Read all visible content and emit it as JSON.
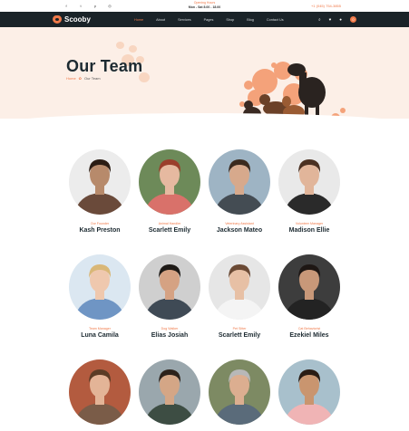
{
  "topbar": {
    "social_icons": [
      "facebook-icon",
      "twitter-icon",
      "pinterest-icon",
      "instagram-icon"
    ],
    "opening_title": "Opening Hours",
    "opening_value": "Mon - Sat 8.00 - 18.00",
    "phone": "+1 (045) 754-3855"
  },
  "nav": {
    "brand": "Scooby",
    "items": [
      {
        "label": "Home",
        "active": true
      },
      {
        "label": "About",
        "active": false
      },
      {
        "label": "Services",
        "active": false
      },
      {
        "label": "Pages",
        "active": false
      },
      {
        "label": "Shop",
        "active": false
      },
      {
        "label": "Blog",
        "active": false
      },
      {
        "label": "Contact Us",
        "active": false
      }
    ],
    "cart_count": "0"
  },
  "hero": {
    "title": "Our Team",
    "breadcrumb_home": "Home",
    "breadcrumb_current": "Our Team"
  },
  "team": [
    {
      "role": "Our Founder",
      "name": "Kash Preston",
      "skin": "#b78a6b",
      "hair": "#2b1d14",
      "shirt": "#6a4a3a",
      "bg": "#ececec"
    },
    {
      "role": "Animal Handler",
      "name": "Scarlett Emily",
      "skin": "#e6b9a0",
      "hair": "#9b3f2c",
      "shirt": "#d9716a",
      "bg": "#6d8a59"
    },
    {
      "role": "Veterinary Assistant",
      "name": "Jackson Mateo",
      "skin": "#d7a98c",
      "hair": "#3b2a1e",
      "shirt": "#444c53",
      "bg": "#9eb4c4"
    },
    {
      "role": "Volunteer Manager",
      "name": "Madison Ellie",
      "skin": "#e1b59a",
      "hair": "#4b3122",
      "shirt": "#2a2a2a",
      "bg": "#e9e9e9"
    },
    {
      "role": "Team Manager",
      "name": "Luna Camila",
      "skin": "#efc8ae",
      "hair": "#d9b777",
      "shirt": "#6f95c4",
      "bg": "#dbe7f1"
    },
    {
      "role": "Dog Walker",
      "name": "Elias Josiah",
      "skin": "#d5a283",
      "hair": "#1e1a17",
      "shirt": "#3f4a55",
      "bg": "#cfcfcf"
    },
    {
      "role": "Pet Sitter",
      "name": "Scarlett Emily",
      "skin": "#e7c0a5",
      "hair": "#6b4a35",
      "shirt": "#f4f4f4",
      "bg": "#e6e6e6"
    },
    {
      "role": "Cat Behaviorist",
      "name": "Ezekiel Miles",
      "skin": "#c89879",
      "hair": "#1e1714",
      "shirt": "#232323",
      "bg": "#3d3d3d"
    },
    {
      "role": "",
      "name": "",
      "skin": "#e3b497",
      "hair": "#5b3c26",
      "shirt": "#7a5c48",
      "bg": "#b35b3f"
    },
    {
      "role": "",
      "name": "",
      "skin": "#d4a686",
      "hair": "#2c211a",
      "shirt": "#3d4d43",
      "bg": "#9aa7ad"
    },
    {
      "role": "",
      "name": "",
      "skin": "#dcae90",
      "hair": "#b8b8b8",
      "shirt": "#5a6b7a",
      "bg": "#7d8a63"
    },
    {
      "role": "",
      "name": "",
      "skin": "#c9956f",
      "hair": "#2a1c14",
      "shirt": "#f0b4b5",
      "bg": "#a8c0cc"
    }
  ],
  "colors": {
    "accent": "#f07a4a",
    "dark": "#1a2328",
    "hero_bg": "#fcefe7"
  }
}
